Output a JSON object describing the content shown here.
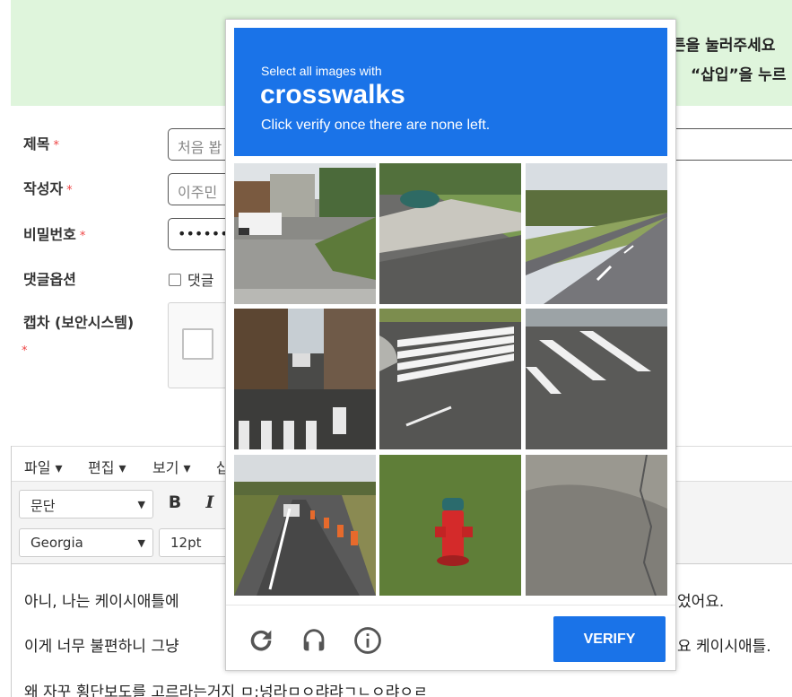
{
  "notice": {
    "line1": "튼을 눌러주세요",
    "line2": "“삽입”을 누르"
  },
  "form": {
    "title_label": "제목",
    "author_label": "작성자",
    "password_label": "비밀번호",
    "comment_label": "댓글옵션",
    "captcha_label": "캡차 (보안시스템)",
    "required_mark": "*",
    "title_placeholder": "처음 봡",
    "author_value": "이주민",
    "password_value": "•••••••",
    "comment_checkbox_label": "댓글"
  },
  "editor": {
    "menu": [
      "파일 ▾",
      "편집 ▾",
      "보기 ▾",
      "삽"
    ],
    "paragraph_select": "문단",
    "font_select": "Georgia",
    "size_select": "12pt",
    "bold": "B",
    "italic": "I",
    "lines": [
      "아니, 나는 케이시애틀에",
      "이게 너무 불편하니 그냥",
      "왜 자꾸 횡단보도를 고르라는거지 ㅁ;넝라ㅁㅇ랴랴ㄱㄴㅇ랴ㅇㄹ"
    ],
    "line1_tail": "었어요.",
    "line2_tail": "요 케이시애틀."
  },
  "recaptcha": {
    "header_prefix": "Select all images with",
    "target": "crosswalks",
    "instruction": "Click verify once there are none left.",
    "verify_label": "VERIFY",
    "header_color": "#1a73e8",
    "tiles": [
      {
        "scene": "street-intersection-van"
      },
      {
        "scene": "road-curb-car"
      },
      {
        "scene": "highway-lanes"
      },
      {
        "scene": "city-street-crosswalk"
      },
      {
        "scene": "crosswalk-corner"
      },
      {
        "scene": "crosswalk-stripes"
      },
      {
        "scene": "road-traffic-cones"
      },
      {
        "scene": "fire-hydrant-grass"
      },
      {
        "scene": "cracked-pavement"
      }
    ],
    "footer_icons": [
      "reload-icon",
      "audio-icon",
      "info-icon"
    ]
  }
}
